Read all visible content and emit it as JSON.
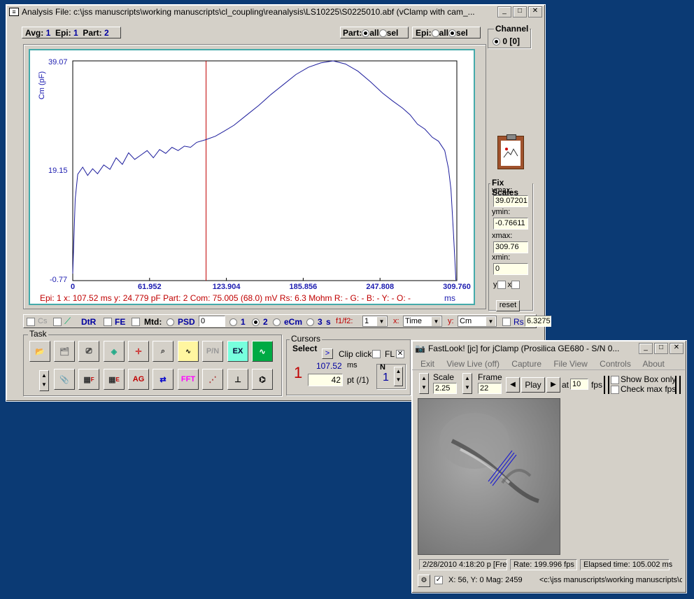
{
  "analysis": {
    "title": "Analysis  File: c:\\jss manuscripts\\working manuscripts\\cl_coupling\\reanalysis\\LS10225\\S0225010.abf (vClamp with cam_...",
    "avg_label": "Avg:",
    "avg_val": "1",
    "epi_label": "Epi:",
    "epi_val": "1",
    "part_label": "Part:",
    "part_val": "2",
    "part_sel_label": "Part:",
    "all": "all",
    "sel": "sel",
    "epi_sel_label": "Epi:",
    "channel": {
      "label": "Channel",
      "value": "0",
      "bracket": "[0]"
    },
    "plot": {
      "ylabel": "Cm (pF)",
      "xunit": "ms",
      "ytick_top": "39.07",
      "ytick_mid": "19.15",
      "ytick_bot": "-0.77",
      "xticks": [
        "0",
        "61.952",
        "123.904",
        "185.856",
        "247.808",
        "309.760"
      ],
      "status": "Epi: 1  x: 107.52 ms   y: 24.779 pF  Part:  2  Com:  75.005 (68.0) mV  Rs: 6.3 Mohm R: - G: - B: - Y: - O: -"
    },
    "fix_scales": {
      "label": "Fix Scales",
      "ymax_label": "ymax:",
      "ymax": "39.07201",
      "ymin_label": "ymin:",
      "ymin": "-0.76611",
      "xmax_label": "xmax:",
      "xmax": "309.76",
      "xmin_label": "xmin:",
      "xmin": "0",
      "y": "y",
      "x": "x",
      "reset": "reset"
    },
    "toolbar": {
      "cs": "Cs",
      "dtr": "DtR",
      "fe": "FE",
      "mtd": "Mtd:",
      "psd": "PSD",
      "psd_val": "0",
      "r1": "1",
      "r2": "2",
      "ecm": "eCm",
      "r3": "3",
      "s": "s",
      "f12": "f1/f2:",
      "f12_val": "1",
      "x_label": "x:",
      "x_val": "Time",
      "y_label": "y:",
      "y_val": "Cm",
      "rs": "Rs",
      "rs_val": "6.3275"
    },
    "task": {
      "label": "Task",
      "pn": "P/N",
      "ex": "EX",
      "ag": "AG",
      "fft": "FFT",
      "f": "F",
      "e": "E"
    },
    "cursors": {
      "label": "Cursors",
      "select": "Select",
      "go": ">",
      "clip": "Clip click",
      "fl": "FL",
      "num": "1",
      "ms_val": "107.52",
      "ms": "ms",
      "pt_val": "42",
      "pt": "pt (/1)",
      "n_label": "N",
      "n_val": "1"
    }
  },
  "fastlook": {
    "title": "FastLook! [jc] for jClamp (Prosilica GE680 - S/N 0...",
    "menu": [
      "Exit",
      "View Live (off)",
      "Capture",
      "File View",
      "Controls",
      "About"
    ],
    "scale_label": "Scale",
    "scale_val": "2.25",
    "frame_label": "Frame",
    "frame_val": "22",
    "play": "Play",
    "at": "at",
    "fps_val": "10",
    "fps": "fps",
    "show_box": "Show Box only",
    "check_fps": "Check max fps",
    "date": "2/28/2010 4:18:20 p [Fre",
    "rate": "Rate: 199.996 fps",
    "elapsed": "Elapsed time: 105.002 ms",
    "coords": "X:  56, Y:   0  Mag:  2459",
    "path": "<c:\\jss manuscripts\\working manuscripts\\cl"
  },
  "chart_data": {
    "type": "line",
    "ylabel": "Cm (pF)",
    "xlabel": "ms",
    "xlim": [
      0,
      309.76
    ],
    "ylim": [
      -0.77,
      39.07
    ],
    "cursor_x": 107.52,
    "x": [
      0,
      2,
      4,
      8,
      12,
      16,
      20,
      25,
      30,
      35,
      40,
      45,
      50,
      55,
      60,
      65,
      70,
      75,
      80,
      85,
      90,
      95,
      100,
      107.5,
      115,
      122,
      130,
      140,
      150,
      160,
      170,
      180,
      190,
      200,
      210,
      220,
      230,
      240,
      250,
      258,
      266,
      272,
      278,
      284,
      290,
      295,
      300,
      303,
      305,
      307,
      309
    ],
    "y": [
      0.5,
      14,
      18.5,
      19.8,
      18.3,
      19.5,
      18.6,
      20.2,
      19.4,
      21.5,
      20.3,
      22.4,
      21.2,
      22.0,
      22.8,
      21.5,
      23.0,
      22.3,
      23.4,
      22.8,
      23.6,
      23.4,
      24.3,
      24.8,
      25.4,
      26.3,
      27.4,
      29.2,
      31.0,
      33.0,
      34.8,
      36.6,
      37.9,
      38.7,
      39.07,
      38.5,
      37.2,
      35.3,
      33.2,
      31.8,
      30.5,
      29.3,
      27.6,
      26.7,
      25.2,
      24.5,
      22.8,
      19.6,
      15.8,
      8.0,
      -0.77
    ],
    "colors": {
      "line": "#1c1c9c",
      "cursor": "#c00000"
    }
  }
}
